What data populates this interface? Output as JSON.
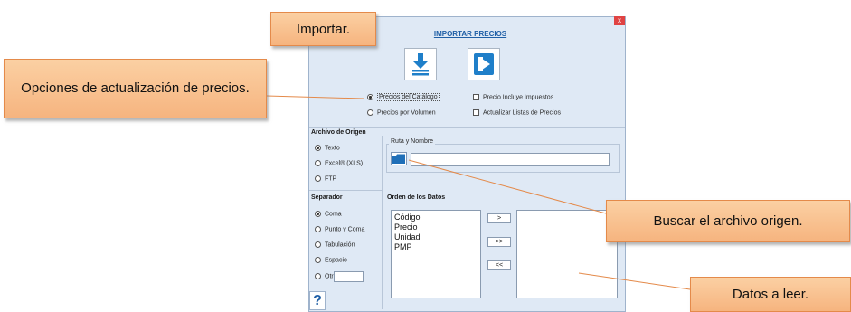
{
  "dialog": {
    "title": "IMPORTAR PRECIOS",
    "close_label": "x",
    "help_label": "?"
  },
  "options": {
    "precios_catalogo": "Precios del Catálogo",
    "precios_volumen": "Precios por Volumen",
    "precio_impuestos": "Precio Incluye Impuestos",
    "actualizar_listas": "Actualizar Listas de Precios"
  },
  "archivo_origen": {
    "heading": "Archivo de Origen",
    "options": [
      "Texto",
      "Excel® (XLS)",
      "FTP"
    ],
    "selected": "Texto"
  },
  "ruta": {
    "label": "Ruta y Nombre",
    "value": ""
  },
  "separador": {
    "heading": "Separador",
    "options": [
      "Coma",
      "Punto y Coma",
      "Tabulación",
      "Espacio",
      "Otro"
    ],
    "selected": "Coma",
    "otro_value": ""
  },
  "orden": {
    "heading": "Orden de los Datos",
    "available": [
      "Código",
      "Precio",
      "Unidad",
      "PMP"
    ],
    "selected": [],
    "buttons": {
      "add": ">",
      "add_all": ">>",
      "remove": "<<"
    }
  },
  "callouts": {
    "importar": "Importar.",
    "opciones": "Opciones de actualización de precios.",
    "buscar": "Buscar el archivo origen.",
    "datos": "Datos a leer."
  },
  "colors": {
    "dialog_bg": "#dfe9f5",
    "accent": "#1f5fa6",
    "callout_fill": "#f8c08f",
    "callout_border": "#e48a4a",
    "close_red": "#e04343"
  }
}
